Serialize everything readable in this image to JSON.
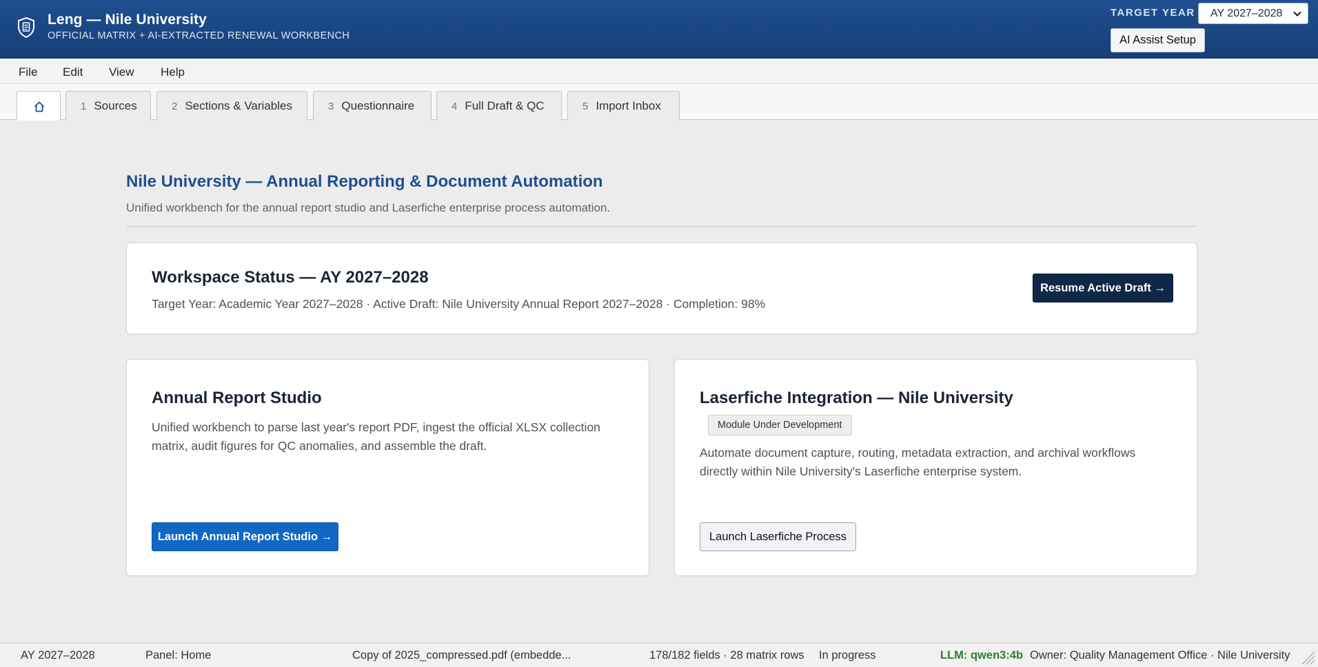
{
  "header": {
    "title": "Leng — Nile University",
    "subtitle": "OFFICIAL MATRIX + AI-EXTRACTED RENEWAL WORKBENCH",
    "target_year_label": "TARGET YEAR",
    "target_year_value": "AY 2027–2028",
    "ai_assist_label": "AI Assist Setup"
  },
  "menubar": {
    "items": [
      {
        "label": "File"
      },
      {
        "label": "Edit"
      },
      {
        "label": "View"
      },
      {
        "label": "Help"
      }
    ]
  },
  "tabs": [
    {
      "num": "",
      "label": "",
      "icon": "home-icon",
      "active": true
    },
    {
      "num": "1",
      "label": "Sources"
    },
    {
      "num": "2",
      "label": "Sections & Variables"
    },
    {
      "num": "3",
      "label": "Questionnaire"
    },
    {
      "num": "4",
      "label": "Full Draft & QC"
    },
    {
      "num": "5",
      "label": "Import Inbox"
    }
  ],
  "hero": {
    "title": "Nile University — Annual Reporting & Document Automation",
    "subtitle": "Unified workbench for the annual report studio and Laserfiche enterprise process automation."
  },
  "workspace": {
    "title": "Workspace Status — AY 2027–2028",
    "detail": "Target Year: Academic Year 2027–2028 · Active Draft: Nile University Annual Report 2027–2028 · Completion: 98%",
    "resume_label": "Resume Active Draft →"
  },
  "studio": {
    "title": "Annual Report Studio",
    "description": "Unified workbench to parse last year's report PDF, ingest the official XLSX collection matrix, audit figures for QC anomalies, and assemble the draft.",
    "launch_label": "Launch Annual Report Studio →"
  },
  "laserfiche": {
    "title": "Laserfiche Integration — Nile University",
    "badge": "Module Under Development",
    "description": "Automate document capture, routing, metadata extraction, and archival workflows directly within Nile University's Laserfiche enterprise system.",
    "launch_label": "Launch Laserfiche Process"
  },
  "statusbar": {
    "year": "AY 2027–2028",
    "panel": "Panel: Home",
    "file": "Copy of 2025_compressed.pdf (embedde...",
    "fields": "178/182 fields · 28 matrix rows",
    "state": "In progress",
    "llm": "LLM: qwen3:4b",
    "owner": "Owner: Quality Management Office · Nile University"
  },
  "colors": {
    "header_bg": "#1f4f91",
    "accent_blue": "#1168c4",
    "dark_button": "#0f2748",
    "hero_title": "#1d4f8f",
    "llm_green": "#2e7d32"
  }
}
